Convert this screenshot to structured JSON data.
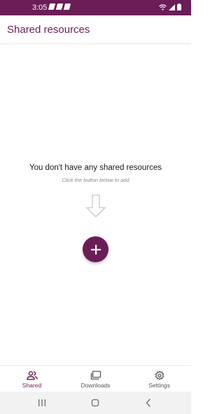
{
  "status_bar": {
    "time": "3:05",
    "background": "#6b1d57"
  },
  "app_bar": {
    "title": "Shared resources"
  },
  "empty_state": {
    "title": "You don't have any shared resources",
    "subtitle": "Click the button below to add",
    "arrow_icon": "arrow-down-outline-icon"
  },
  "fab": {
    "icon": "plus-icon",
    "color": "#6b1d57"
  },
  "bottom_nav": {
    "items": [
      {
        "label": "Shared",
        "icon": "people-icon",
        "active": true
      },
      {
        "label": "Downloads",
        "icon": "folders-icon",
        "active": false
      },
      {
        "label": "Settings",
        "icon": "gear-icon",
        "active": false
      }
    ]
  },
  "system_nav": {
    "buttons": [
      "recent-apps-icon",
      "home-icon",
      "back-icon"
    ]
  },
  "colors": {
    "accent": "#6b1d57",
    "inactive": "#555555"
  }
}
